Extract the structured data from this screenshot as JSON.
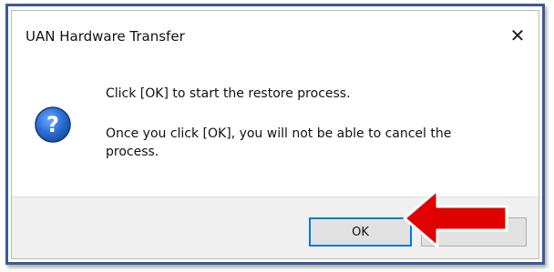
{
  "dialog": {
    "title": "UAN Hardware Transfer",
    "close_label": "✕",
    "message_primary": "Click [OK] to start the restore process.",
    "message_secondary": "Once you click [OK], you will not be able to cancel the process.",
    "ok_label": "OK",
    "cancel_label": ""
  },
  "icons": {
    "dialog_icon": "question-icon",
    "annotation": "red-arrow-icon"
  },
  "colors": {
    "frame_border": "#3c5a96",
    "question_icon": "#1f5fbf",
    "arrow": "#e00000",
    "ok_focus": "#0078d7"
  }
}
